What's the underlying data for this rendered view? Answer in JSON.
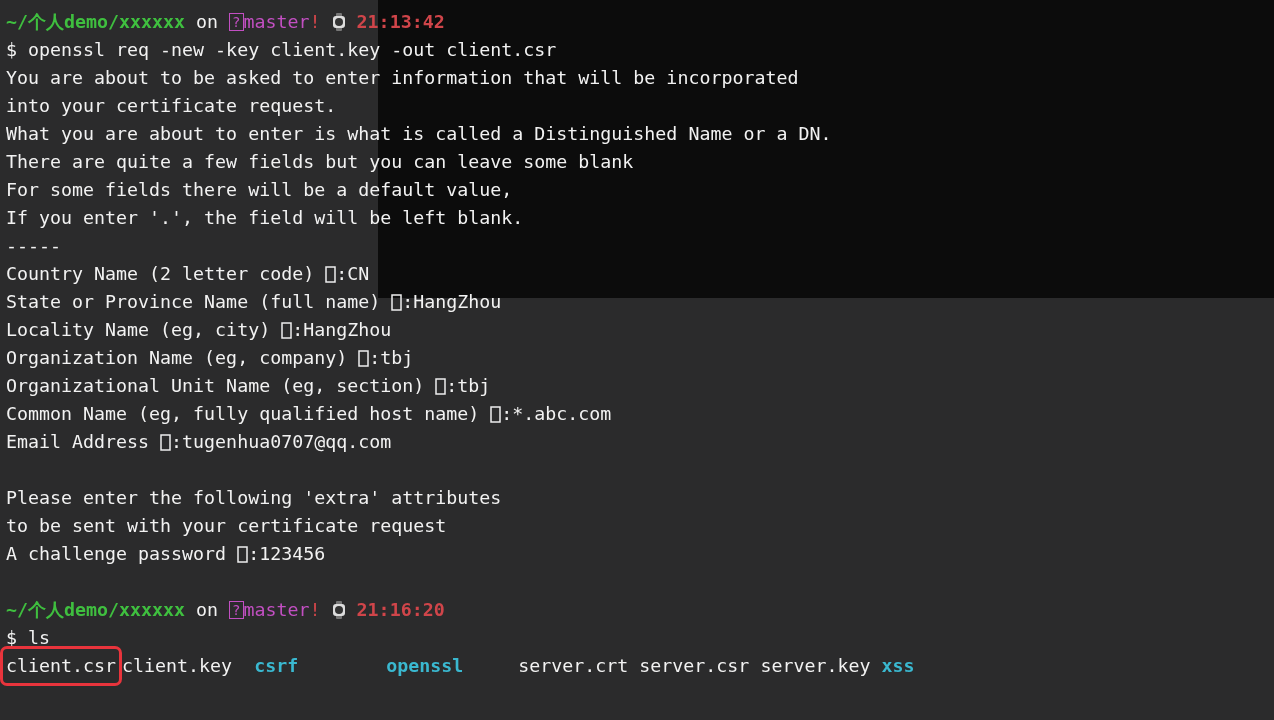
{
  "blocks": [
    {
      "kind": "prompt",
      "path": "~/个人demo/xxxxxx",
      "on": "on",
      "branch_mark": "?",
      "branch": "master",
      "dirty": "!",
      "time": "21:13:42"
    },
    {
      "kind": "command",
      "text": "$ openssl req -new -key client.key -out client.csr"
    },
    {
      "kind": "output",
      "text": "You are about to be asked to enter information that will be incorporated"
    },
    {
      "kind": "output",
      "text": "into your certificate request."
    },
    {
      "kind": "output",
      "text": "What you are about to enter is what is called a Distinguished Name or a DN."
    },
    {
      "kind": "output",
      "text": "There are quite a few fields but you can leave some blank"
    },
    {
      "kind": "output",
      "text": "For some fields there will be a default value,"
    },
    {
      "kind": "output",
      "text": "If you enter '.', the field will be left blank."
    },
    {
      "kind": "output",
      "text": "-----"
    },
    {
      "kind": "field",
      "label": "Country Name (2 letter code) ",
      "value": ":CN"
    },
    {
      "kind": "field",
      "label": "State or Province Name (full name) ",
      "value": ":HangZhou"
    },
    {
      "kind": "field",
      "label": "Locality Name (eg, city) ",
      "value": ":HangZhou"
    },
    {
      "kind": "field",
      "label": "Organization Name (eg, company) ",
      "value": ":tbj"
    },
    {
      "kind": "field",
      "label": "Organizational Unit Name (eg, section) ",
      "value": ":tbj"
    },
    {
      "kind": "field",
      "label": "Common Name (eg, fully qualified host name) ",
      "value": ":*.abc.com"
    },
    {
      "kind": "field",
      "label": "Email Address ",
      "value": ":tugenhua0707@qq.com"
    },
    {
      "kind": "blank"
    },
    {
      "kind": "output",
      "text": "Please enter the following 'extra' attributes"
    },
    {
      "kind": "output",
      "text": "to be sent with your certificate request"
    },
    {
      "kind": "field",
      "label": "A challenge password ",
      "value": ":123456"
    },
    {
      "kind": "blank"
    },
    {
      "kind": "prompt",
      "path": "~/个人demo/xxxxxx",
      "on": "on",
      "branch_mark": "?",
      "branch": "master",
      "dirty": "!",
      "time": "21:16:20"
    },
    {
      "kind": "command",
      "text": "$ ls"
    },
    {
      "kind": "listing",
      "items": [
        {
          "name": "client.csr",
          "kind": "file",
          "highlighted": true
        },
        {
          "name": "client.key",
          "kind": "file",
          "highlighted": false
        },
        {
          "name": "csrf",
          "kind": "directory",
          "highlighted": false
        },
        {
          "name": "openssl",
          "kind": "directory",
          "highlighted": false
        },
        {
          "name": "server.crt",
          "kind": "file",
          "highlighted": false
        },
        {
          "name": "server.csr",
          "kind": "file",
          "highlighted": false
        },
        {
          "name": "server.key",
          "kind": "file",
          "highlighted": false
        },
        {
          "name": "xss",
          "kind": "directory",
          "highlighted": false
        }
      ]
    }
  ]
}
